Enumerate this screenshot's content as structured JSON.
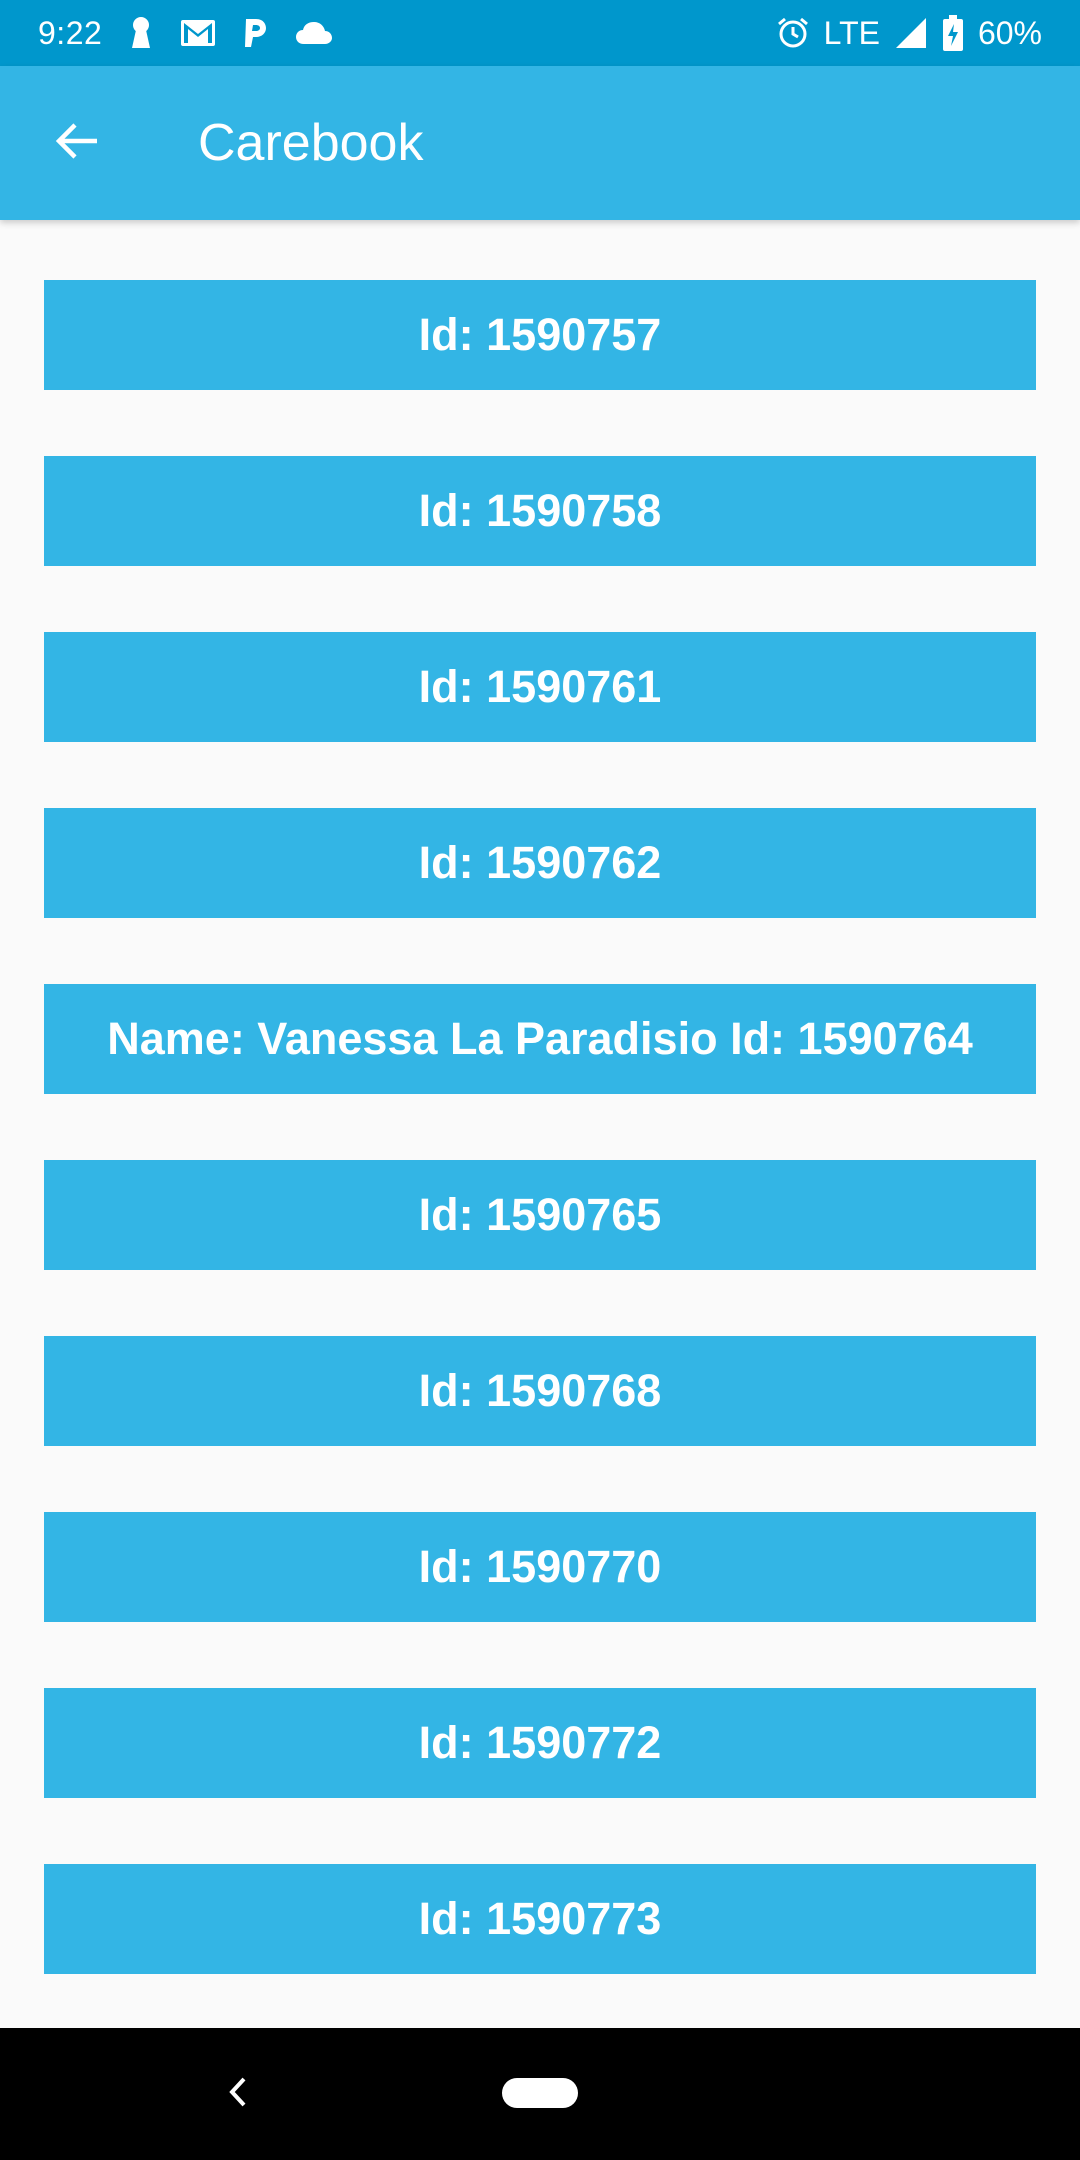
{
  "status_bar": {
    "time": "9:22",
    "network": "LTE",
    "battery": "60%",
    "left_icons": [
      "keyhole-icon",
      "gmail-icon",
      "p-icon",
      "cloud-icon"
    ],
    "right_icons": [
      "alarm-icon",
      "signal-icon",
      "battery-charging-icon"
    ]
  },
  "app_bar": {
    "title": "Carebook",
    "back_icon": "arrow-left-icon"
  },
  "list": {
    "items": [
      {
        "label": "Id: 1590757"
      },
      {
        "label": "Id: 1590758"
      },
      {
        "label": "Id: 1590761"
      },
      {
        "label": "Id: 1590762"
      },
      {
        "label": "Name: Vanessa La Paradisio Id: 1590764"
      },
      {
        "label": "Id: 1590765"
      },
      {
        "label": "Id: 1590768"
      },
      {
        "label": "Id: 1590770"
      },
      {
        "label": "Id: 1590772"
      },
      {
        "label": "Id: 1590773"
      }
    ]
  },
  "nav_bar": {
    "back_icon": "chevron-left-icon",
    "home_icon": "home-pill-icon"
  },
  "colors": {
    "status_bar": "#0097cc",
    "accent": "#33b5e5",
    "background": "#fafafa",
    "nav_bar": "#000000",
    "text": "#ffffff"
  }
}
